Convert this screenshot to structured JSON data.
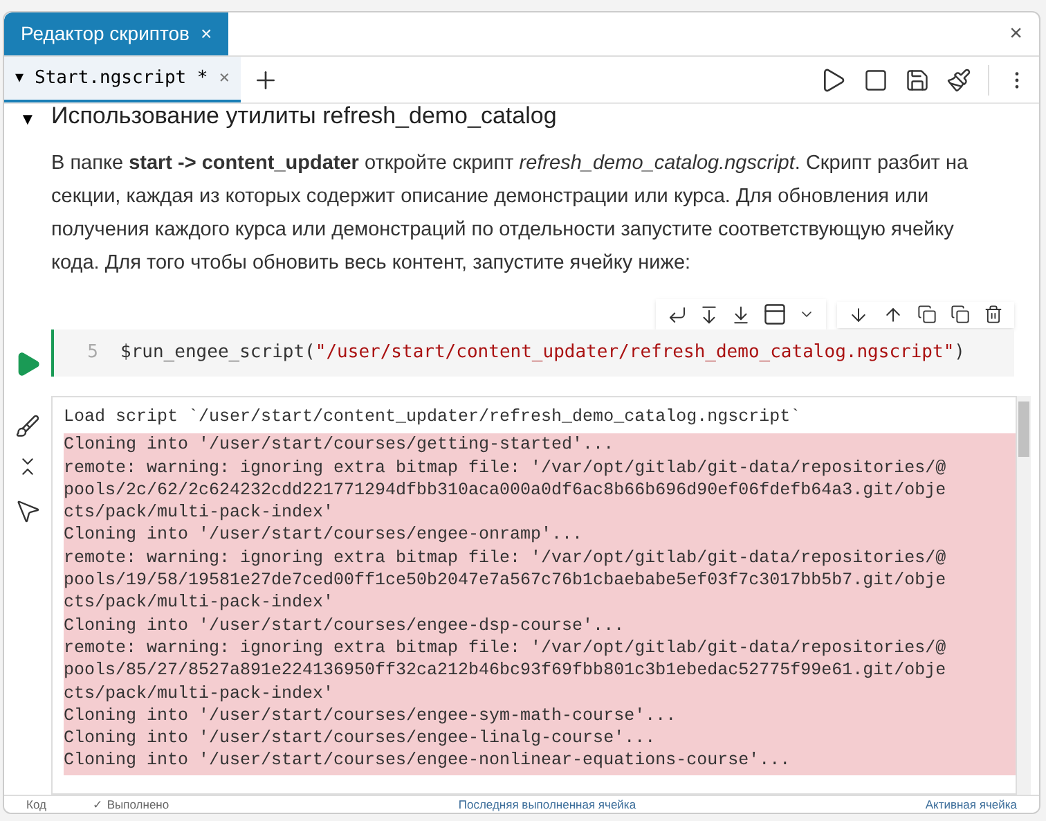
{
  "window_tab": {
    "title": "Редактор скриптов",
    "close": "×"
  },
  "window_close": "×",
  "file_tabs": [
    {
      "caret": "▼",
      "label": "Start.ngscript *",
      "selected": true,
      "close": "×"
    }
  ],
  "section_caret": "▼",
  "heading": "Использование утилиты refresh_demo_catalog",
  "paragraph": "В папке **start -> content_updater** откройте скрипт *refresh_demo_catalog.ngscript*. Скрипт разбит на секции, каждая из которых содержит описание демонстрации или курса. Для обновления или получения каждого курса или демонстраций по отдельности запустите соответствующую ячейку кода. Для того чтобы обновить весь контент, запустите ячейку ниже:",
  "code_cell": {
    "line_number": "5",
    "code_prefix": "$run_engee_script(",
    "code_string": "\"/user/start/content_updater/refresh_demo_catalog.ngscript\"",
    "code_suffix": ")"
  },
  "output": {
    "header": "Load script `/user/start/content_updater/refresh_demo_catalog.ngscript`",
    "lines": [
      "Cloning into '/user/start/courses/getting-started'...",
      "remote: warning: ignoring extra bitmap file: '/var/opt/gitlab/git-data/repositories/@",
      "pools/2c/62/2c624232cdd221771294dfbb310aca000a0df6ac8b66b696d90ef06fdefb64a3.git/obje",
      "cts/pack/multi-pack-index'",
      "Cloning into '/user/start/courses/engee-onramp'...",
      "remote: warning: ignoring extra bitmap file: '/var/opt/gitlab/git-data/repositories/@",
      "pools/19/58/19581e27de7ced00ff1ce50b2047e7a567c76b1cbaebabe5ef03f7c3017bb5b7.git/obje",
      "cts/pack/multi-pack-index'",
      "Cloning into '/user/start/courses/engee-dsp-course'...",
      "remote: warning: ignoring extra bitmap file: '/var/opt/gitlab/git-data/repositories/@",
      "pools/85/27/8527a891e224136950ff32ca212b46bc93f69fbb801c3b1ebedac52775f99e61.git/obje",
      "cts/pack/multi-pack-index'",
      "Cloning into '/user/start/courses/engee-sym-math-course'...",
      "Cloning into '/user/start/courses/engee-linalg-course'...",
      "Cloning into '/user/start/courses/engee-nonlinear-equations-course'..."
    ]
  },
  "status_bar": {
    "mode": "Код",
    "status": "✓ Выполнено",
    "last_cell": "Последняя выполненная ячейка",
    "active_cell": "Активная ячейка"
  }
}
